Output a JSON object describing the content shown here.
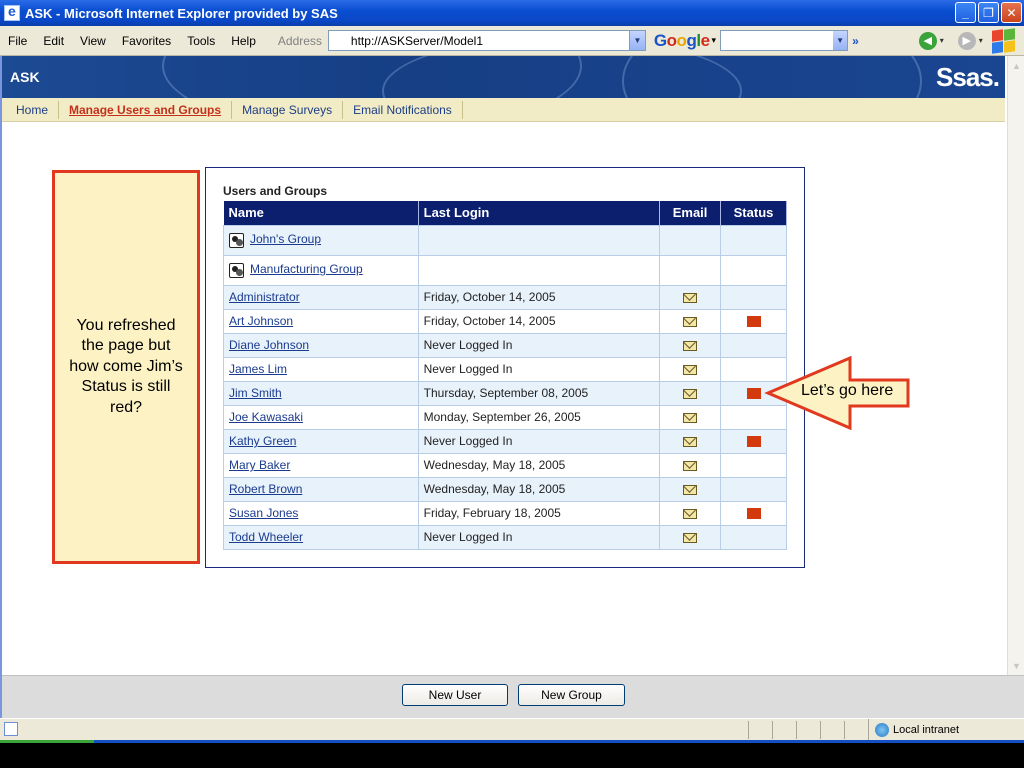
{
  "window": {
    "title": "ASK - Microsoft Internet Explorer provided by SAS",
    "minimize": "_",
    "maximize": "❐",
    "close": "✕"
  },
  "menu": [
    "File",
    "Edit",
    "View",
    "Favorites",
    "Tools",
    "Help"
  ],
  "address": {
    "label": "Address",
    "url": "http://ASKServer/Model1"
  },
  "google": {
    "logo_b1": "G",
    "logo_o1": "o",
    "logo_o2": "o",
    "logo_g": "g",
    "logo_l": "l",
    "logo_e": "e"
  },
  "banner": {
    "app_name": "ASK",
    "brand": "Ssas."
  },
  "tabs": [
    {
      "label": "Home"
    },
    {
      "label": "Manage Users and Groups"
    },
    {
      "label": "Manage Surveys"
    },
    {
      "label": "Email Notifications"
    }
  ],
  "note": "You refreshed the page but how come Jim’s Status is still red?",
  "panel": {
    "title": "Users and Groups",
    "headers": {
      "name": "Name",
      "last_login": "Last Login",
      "email": "Email",
      "status": "Status"
    },
    "rows": [
      {
        "name": "John's Group",
        "last_login": "",
        "group": true,
        "email": false,
        "status_red": false
      },
      {
        "name": "Manufacturing Group",
        "last_login": "",
        "group": true,
        "email": false,
        "status_red": false
      },
      {
        "name": "Administrator",
        "last_login": "Friday, October 14, 2005",
        "email": true,
        "status_red": false
      },
      {
        "name": "Art Johnson",
        "last_login": "Friday, October 14, 2005",
        "email": true,
        "status_red": true
      },
      {
        "name": "Diane Johnson",
        "last_login": "Never Logged In",
        "email": true,
        "status_red": false
      },
      {
        "name": "James Lim",
        "last_login": "Never Logged In",
        "email": true,
        "status_red": false
      },
      {
        "name": "Jim Smith",
        "last_login": "Thursday, September 08, 2005",
        "email": true,
        "status_red": true
      },
      {
        "name": "Joe Kawasaki",
        "last_login": "Monday, September 26, 2005",
        "email": true,
        "status_red": false
      },
      {
        "name": "Kathy Green",
        "last_login": "Never Logged In",
        "email": true,
        "status_red": true
      },
      {
        "name": "Mary Baker",
        "last_login": "Wednesday, May 18, 2005",
        "email": true,
        "status_red": false
      },
      {
        "name": "Robert Brown",
        "last_login": "Wednesday, May 18, 2005",
        "email": true,
        "status_red": false
      },
      {
        "name": "Susan Jones",
        "last_login": "Friday, February 18, 2005",
        "email": true,
        "status_red": true
      },
      {
        "name": "Todd Wheeler",
        "last_login": "Never Logged In",
        "email": true,
        "status_red": false
      }
    ]
  },
  "arrow_callout": "Let’s go here",
  "buttons": {
    "new_user": "New User",
    "new_group": "New Group"
  },
  "statusbar": {
    "zone": "Local intranet"
  },
  "colors": {
    "header_navy": "#0c1f6e",
    "status_red": "#d23a0e",
    "callout_red": "#e0391f",
    "callout_fill": "#fdf2c4",
    "tab_active": "#c4301a"
  }
}
